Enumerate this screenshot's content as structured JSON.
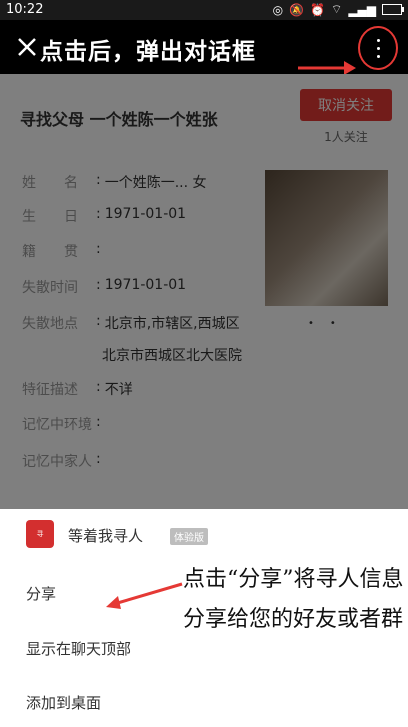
{
  "status_bar": {
    "time": "10:22",
    "icons": [
      "vibrate-icon",
      "mute-icon",
      "alarm-icon",
      "wifi-icon",
      "signal-icon",
      "battery-icon"
    ]
  },
  "top_bar": {
    "close_icon": "close-icon",
    "annotation": "点击后，弹出对话框",
    "more_icon": "more-vertical-icon"
  },
  "page": {
    "title": "寻找父母 一个姓陈一个姓张",
    "cancel_follow": "取消关注",
    "followers": "1人关注",
    "fields": [
      {
        "label": "姓　　名",
        "value": "一个姓陈一...   女"
      },
      {
        "label": "生　　日",
        "value": "1971-01-01"
      },
      {
        "label": "籍　　贯",
        "value": ""
      },
      {
        "label": "失散时间",
        "value": "1971-01-01"
      },
      {
        "label": "失散地点",
        "value": "北京市,市辖区,西城区"
      },
      {
        "label": "",
        "value": "北京市西城区北大医院"
      },
      {
        "label": "特征描述",
        "value": "不详"
      },
      {
        "label": "记忆中环境",
        "value": ""
      },
      {
        "label": "记忆中家人",
        "value": ""
      }
    ]
  },
  "sheet": {
    "app_name": "等着我寻人",
    "badge": "体验版",
    "items": [
      "分享",
      "显示在聊天顶部",
      "添加到桌面"
    ],
    "annotation": "点击“分享”将寻人信息分享给您的好友或者群"
  },
  "colors": {
    "accent": "#e53935",
    "dim": "rgba(0,0,0,0.5)"
  }
}
